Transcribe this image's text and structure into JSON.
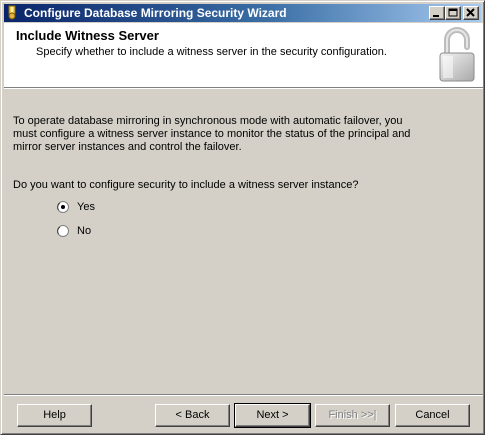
{
  "window": {
    "title": "Configure Database Mirroring Security Wizard"
  },
  "header": {
    "title": "Include Witness Server",
    "subtitle": "Specify whether to include a witness server in the security configuration."
  },
  "body": {
    "description": "To operate database mirroring in synchronous mode with automatic failover, you must configure a witness server instance to monitor the status of the principal and mirror server instances and control the failover.",
    "question": "Do you want to configure security to include a witness server instance?",
    "options": [
      {
        "label": "Yes",
        "selected": true
      },
      {
        "label": "No",
        "selected": false
      }
    ]
  },
  "buttons": {
    "help": "Help",
    "back": "< Back",
    "next": "Next >",
    "finish": "Finish >>|",
    "cancel": "Cancel"
  },
  "icons": {
    "app": "wizard-key-icon",
    "header": "padlock-icon"
  }
}
